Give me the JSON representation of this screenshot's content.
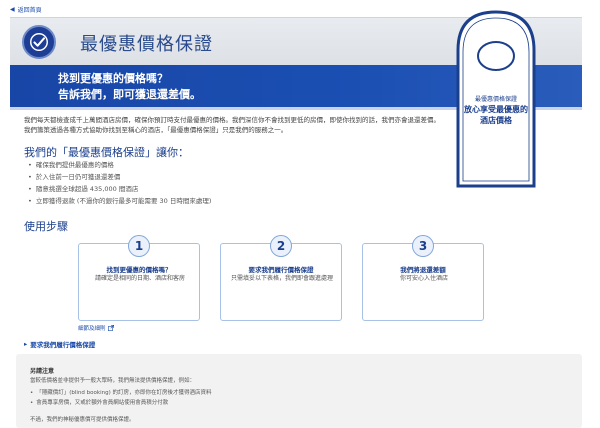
{
  "nav": {
    "back_label": "返回首頁"
  },
  "header": {
    "title": "最優惠價格保證"
  },
  "banner": {
    "line1": "找到更優惠的價格嗎？",
    "line2": "告訴我們，即可獲退還差價。"
  },
  "tag": {
    "small": "最優惠價格保證",
    "line1": "放心享受最優惠的",
    "line2": "酒店價格"
  },
  "intro": {
    "text": "我們每天都檢查成千上萬間酒店房價，確保你預訂時支付最優惠的價格。我們深信你不會找到更低的房價，即使你找到的話，我們亦會退還差價。我們籌策透過各種方式協助你找到至稱心的酒店，「最優惠價格保證」只是我們的服務之一。"
  },
  "promise": {
    "title": "我們的「最優惠價格保證」讓你：",
    "items": [
      "確保我們提供最優惠的價格",
      "於入住前一日仍可獲退還差價",
      "隨意挑選全球超過 435,000 間酒店",
      "立即獲得退款 (不過你的銀行最多可能需要 30 日時間來處理)"
    ]
  },
  "steps": {
    "title": "使用步驟",
    "items": [
      {
        "num": "1",
        "head": "找到更優惠的價格嗎？",
        "desc": "請確定是相同的日期、酒店和客房"
      },
      {
        "num": "2",
        "head": "要求我們履行價格保證",
        "desc": "只需填妥以下表格，我們即會跟進處理"
      },
      {
        "num": "3",
        "head": "我們將退還差額",
        "desc": "你可安心入住酒店"
      }
    ]
  },
  "links": {
    "fineprint": "細節及細則",
    "claim": "要求我們履行價格保證"
  },
  "notes": {
    "title": "另請注意",
    "p1": "當較低價格並非提供予一般大眾時，我們無法提供價格保證，例如：",
    "items": [
      "「隱藏價訂」(blind booking) 的訂房，亦即你在訂房後才獲得酒店資料",
      "會員專享房價，又或於額外會員網站使用會員積分付款"
    ],
    "p2": "不過，我們的神秘優惠價可提供價格保證。"
  },
  "colors": {
    "brand_blue": "#1846a7",
    "link_blue": "#1a4aa8",
    "title_blue": "#2a4b8d"
  },
  "icons": {
    "back": "chevron-left-icon",
    "logo": "checkmark-seal-icon",
    "external": "external-link-icon",
    "claim_arrow": "chevron-right-icon"
  }
}
